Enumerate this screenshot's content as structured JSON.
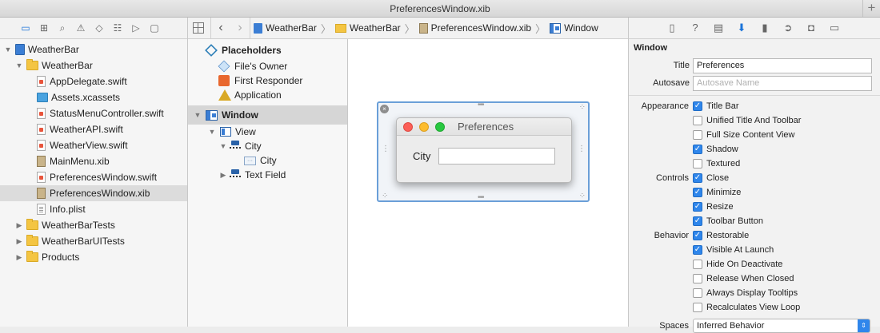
{
  "window": {
    "title": "PreferencesWindow.xib"
  },
  "navigator": {
    "items": [
      {
        "label": "WeatherBar",
        "level": 0,
        "kind": "project",
        "disclosure": "open"
      },
      {
        "label": "WeatherBar",
        "level": 1,
        "kind": "folder",
        "disclosure": "open"
      },
      {
        "label": "AppDelegate.swift",
        "level": 2,
        "kind": "swift"
      },
      {
        "label": "Assets.xcassets",
        "level": 2,
        "kind": "assets"
      },
      {
        "label": "StatusMenuController.swift",
        "level": 2,
        "kind": "swift"
      },
      {
        "label": "WeatherAPI.swift",
        "level": 2,
        "kind": "swift"
      },
      {
        "label": "WeatherView.swift",
        "level": 2,
        "kind": "swift"
      },
      {
        "label": "MainMenu.xib",
        "level": 2,
        "kind": "xib"
      },
      {
        "label": "PreferencesWindow.swift",
        "level": 2,
        "kind": "swift"
      },
      {
        "label": "PreferencesWindow.xib",
        "level": 2,
        "kind": "xib",
        "selected": true
      },
      {
        "label": "Info.plist",
        "level": 2,
        "kind": "plist"
      },
      {
        "label": "WeatherBarTests",
        "level": 1,
        "kind": "folder",
        "disclosure": "closed"
      },
      {
        "label": "WeatherBarUITests",
        "level": 1,
        "kind": "folder",
        "disclosure": "closed"
      },
      {
        "label": "Products",
        "level": 1,
        "kind": "folder",
        "disclosure": "closed"
      }
    ]
  },
  "jumpbar": {
    "crumbs": [
      "WeatherBar",
      "WeatherBar",
      "PreferencesWindow.xib",
      "Window"
    ]
  },
  "outline": {
    "placeholders_header": "Placeholders",
    "placeholders": [
      "File's Owner",
      "First Responder",
      "Application"
    ],
    "window_label": "Window",
    "view_label": "View",
    "city_stack_label": "City",
    "city_label": "City",
    "text_field_label": "Text Field"
  },
  "canvas": {
    "preview_title": "Preferences",
    "preview_field_label": "City"
  },
  "inspector": {
    "header": "Window",
    "title_label": "Title",
    "title_value": "Preferences",
    "autosave_label": "Autosave",
    "autosave_placeholder": "Autosave Name",
    "appearance_label": "Appearance",
    "controls_label": "Controls",
    "behavior_label": "Behavior",
    "appearance": [
      {
        "label": "Title Bar",
        "checked": true
      },
      {
        "label": "Unified Title And Toolbar",
        "checked": false
      },
      {
        "label": "Full Size Content View",
        "checked": false
      },
      {
        "label": "Shadow",
        "checked": true
      },
      {
        "label": "Textured",
        "checked": false
      }
    ],
    "controls": [
      {
        "label": "Close",
        "checked": true
      },
      {
        "label": "Minimize",
        "checked": true
      },
      {
        "label": "Resize",
        "checked": true
      },
      {
        "label": "Toolbar Button",
        "checked": true
      }
    ],
    "behavior": [
      {
        "label": "Restorable",
        "checked": true
      },
      {
        "label": "Visible At Launch",
        "checked": true
      },
      {
        "label": "Hide On Deactivate",
        "checked": false
      },
      {
        "label": "Release When Closed",
        "checked": false
      },
      {
        "label": "Always Display Tooltips",
        "checked": false
      },
      {
        "label": "Recalculates View Loop",
        "checked": false
      }
    ],
    "spaces_label": "Spaces",
    "spaces_value": "Inferred Behavior"
  },
  "colors": {
    "accent": "#2f86eb",
    "selection_blue": "#6a9fd8",
    "folder": "#f4c542"
  }
}
